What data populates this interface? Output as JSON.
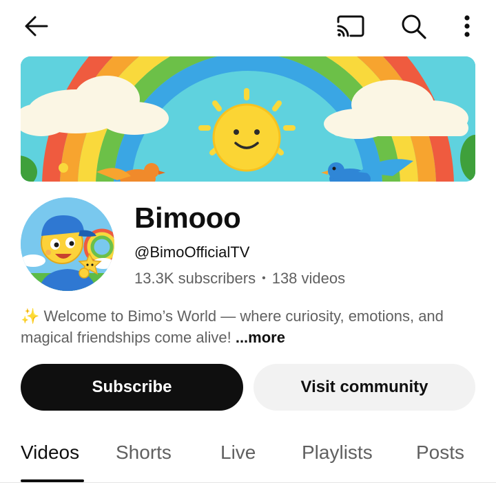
{
  "top_bar": {
    "icons": [
      "back-arrow-icon",
      "cast-icon",
      "search-icon",
      "more-vert-icon"
    ]
  },
  "channel": {
    "name": "Bimooo",
    "handle": "@BimoOfficialTV",
    "subscribers": "13.3K subscribers",
    "separator": "•",
    "videos": "138 videos",
    "description_emoji": "✨",
    "description": "Welcome to Bimo’s World — where curiosity, emotions, and magical friendships come alive!",
    "more_label": "...more"
  },
  "actions": {
    "subscribe_label": "Subscribe",
    "community_label": "Visit community"
  },
  "tabs": [
    {
      "label": "Videos",
      "active": true
    },
    {
      "label": "Shorts",
      "active": false
    },
    {
      "label": "Live",
      "active": false
    },
    {
      "label": "Playlists",
      "active": false
    },
    {
      "label": "Posts",
      "active": false
    }
  ],
  "colors": {
    "text_primary": "#0f0f0f",
    "text_secondary": "#606060",
    "subscribe_bg": "#0f0f0f",
    "secondary_button_bg": "#f2f2f2",
    "banner_sky": "#5fd2de"
  }
}
